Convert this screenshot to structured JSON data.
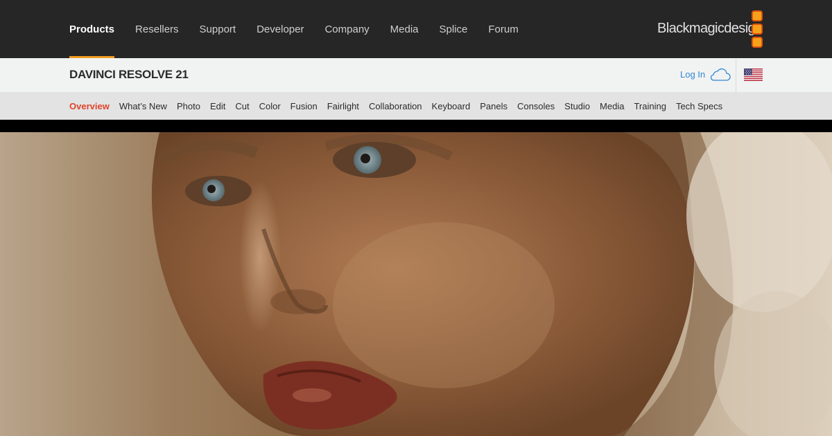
{
  "top_nav": {
    "links": [
      {
        "label": "Products",
        "active": true
      },
      {
        "label": "Resellers"
      },
      {
        "label": "Support"
      },
      {
        "label": "Developer"
      },
      {
        "label": "Company"
      },
      {
        "label": "Media"
      },
      {
        "label": "Splice"
      },
      {
        "label": "Forum"
      }
    ],
    "logo_text": "Blackmagicdesign",
    "active_underline_color": "#f19a1f"
  },
  "product_bar": {
    "title": "DAVINCI RESOLVE 21",
    "login_label": "Log In",
    "login_icon": "cloud-icon",
    "region_icon": "us-flag-icon",
    "login_color": "#2e86d6"
  },
  "sub_nav": {
    "items": [
      {
        "label": "Overview",
        "active": true
      },
      {
        "label": "What’s New"
      },
      {
        "label": "Photo"
      },
      {
        "label": "Edit"
      },
      {
        "label": "Cut"
      },
      {
        "label": "Color"
      },
      {
        "label": "Fusion"
      },
      {
        "label": "Fairlight"
      },
      {
        "label": "Collaboration"
      },
      {
        "label": "Keyboard"
      },
      {
        "label": "Panels"
      },
      {
        "label": "Consoles"
      },
      {
        "label": "Studio"
      },
      {
        "label": "Media"
      },
      {
        "label": "Training"
      },
      {
        "label": "Tech Specs"
      }
    ],
    "active_color": "#e0432a"
  },
  "hero": {
    "image": "close-up-face-hero-image"
  }
}
